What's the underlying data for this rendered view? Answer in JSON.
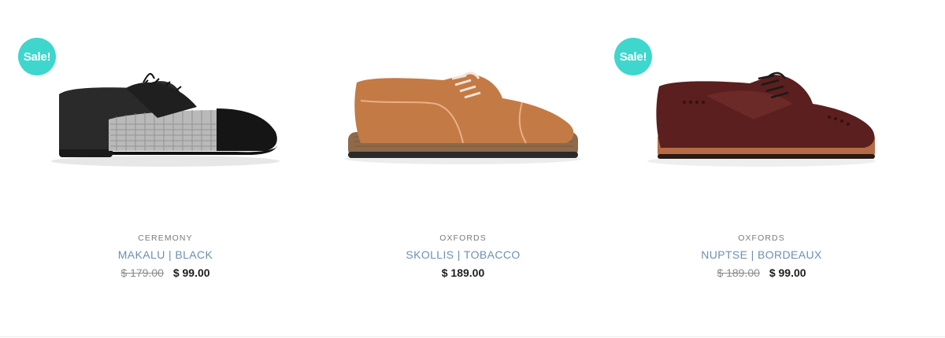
{
  "products": [
    {
      "badge": "Sale!",
      "image_icon": "shoe-oxford-black-check-icon",
      "category": "CEREMONY",
      "name": "MAKALU | BLACK",
      "old_price": "$ 179.00",
      "price": "$ 99.00",
      "colors": {
        "leather": "#1f1f1f",
        "panel": "#b9b9b9"
      }
    },
    {
      "image_icon": "shoe-oxford-suede-tan-icon",
      "category": "OXFORDS",
      "name": "SKOLLIS | TOBACCO",
      "price": "$ 189.00",
      "colors": {
        "leather": "#c47a45",
        "sole": "#8f6a4a"
      }
    },
    {
      "badge": "Sale!",
      "image_icon": "shoe-oxford-brogue-burgundy-icon",
      "category": "OXFORDS",
      "name": "NUPTSE | BORDEAUX",
      "old_price": "$ 189.00",
      "price": "$ 99.00",
      "colors": {
        "leather": "#5a1f1e",
        "sole": "#b56b45"
      }
    }
  ],
  "theme": {
    "sale_badge": "#3fd6ce",
    "title_link": "#6d8fb4",
    "category_text": "#7b7b7b"
  }
}
